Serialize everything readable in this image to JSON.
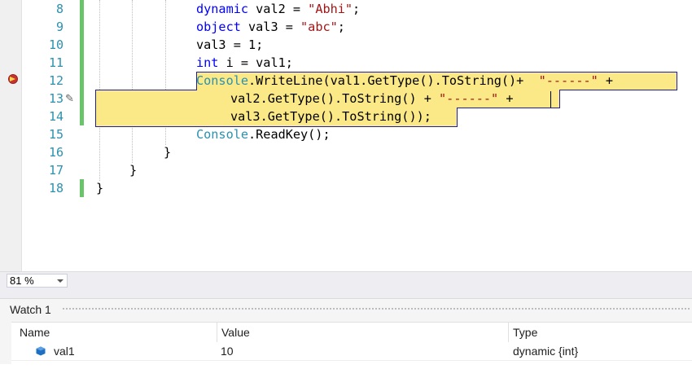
{
  "editor": {
    "line_numbers": [
      "8",
      "9",
      "10",
      "11",
      "12",
      "13",
      "14",
      "15",
      "16",
      "17",
      "18"
    ],
    "lines": {
      "l8": [
        {
          "t": "dynamic",
          "c": "kw"
        },
        {
          "t": " val2 = "
        },
        {
          "t": "\"Abhi\"",
          "c": "str"
        },
        {
          "t": ";"
        }
      ],
      "l9": [
        {
          "t": "object",
          "c": "kw"
        },
        {
          "t": " val3 = "
        },
        {
          "t": "\"abc\"",
          "c": "str"
        },
        {
          "t": ";"
        }
      ],
      "l10": [
        {
          "t": "val3 = 1;"
        }
      ],
      "l11": [
        {
          "t": "int",
          "c": "kw"
        },
        {
          "t": " i = val1;"
        }
      ],
      "l12": [
        {
          "t": "Console",
          "c": "type"
        },
        {
          "t": ".WriteLine(val1.GetType().ToString()+  "
        },
        {
          "t": "\"------\"",
          "c": "str"
        },
        {
          "t": " +"
        }
      ],
      "l13": [
        {
          "t": "val2.GetType().ToString() + "
        },
        {
          "t": "\"------\"",
          "c": "str"
        },
        {
          "t": " +"
        }
      ],
      "l14": [
        {
          "t": "val3.GetType().ToString());"
        }
      ],
      "l15": [
        {
          "t": "Console",
          "c": "type"
        },
        {
          "t": ".ReadKey();"
        }
      ],
      "l16": [
        {
          "t": "}"
        }
      ],
      "l17": [
        {
          "t": "}"
        }
      ],
      "l18": [
        {
          "t": "}"
        }
      ]
    }
  },
  "zoom": {
    "value": "81 %"
  },
  "watch": {
    "title": "Watch 1",
    "columns": {
      "name": "Name",
      "value": "Value",
      "type": "Type"
    },
    "rows": [
      {
        "name": "val1",
        "value": "10",
        "type": "dynamic {int}"
      }
    ]
  },
  "colors": {
    "keyword": "#0000ff",
    "string": "#a31515",
    "type": "#2b91af",
    "statement_highlight": "#fbe887",
    "statement_border": "#1f1f9e",
    "changed_bar": "#6ac46a",
    "breakpoint": "#c5342c"
  }
}
